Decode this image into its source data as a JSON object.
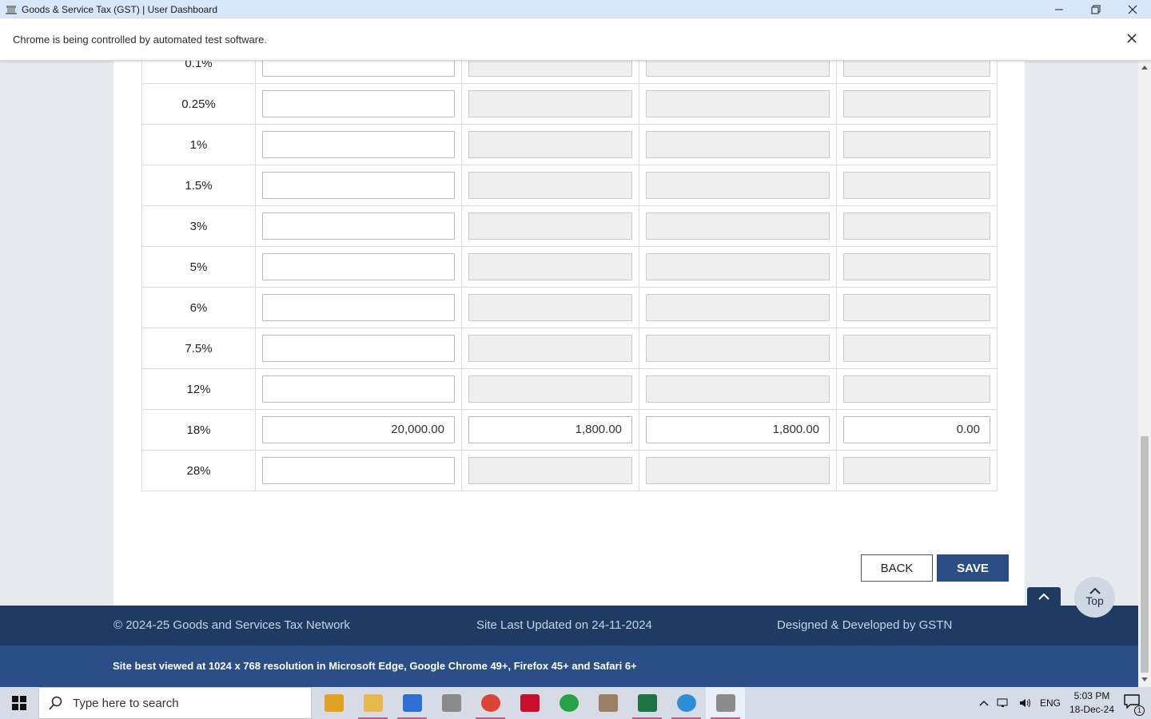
{
  "window": {
    "title": "Goods & Service Tax (GST) | User Dashboard",
    "controls": [
      "minimize-icon",
      "restore-icon",
      "close-icon"
    ]
  },
  "infobar": {
    "message": "Chrome is being controlled by automated test software."
  },
  "table": {
    "rows": [
      {
        "rate": "0.1%",
        "taxable_value": "",
        "integrated_tax": "",
        "central_tax": "",
        "state_tax": ""
      },
      {
        "rate": "0.25%",
        "taxable_value": "",
        "integrated_tax": "",
        "central_tax": "",
        "state_tax": ""
      },
      {
        "rate": "1%",
        "taxable_value": "",
        "integrated_tax": "",
        "central_tax": "",
        "state_tax": ""
      },
      {
        "rate": "1.5%",
        "taxable_value": "",
        "integrated_tax": "",
        "central_tax": "",
        "state_tax": ""
      },
      {
        "rate": "3%",
        "taxable_value": "",
        "integrated_tax": "",
        "central_tax": "",
        "state_tax": ""
      },
      {
        "rate": "5%",
        "taxable_value": "",
        "integrated_tax": "",
        "central_tax": "",
        "state_tax": ""
      },
      {
        "rate": "6%",
        "taxable_value": "",
        "integrated_tax": "",
        "central_tax": "",
        "state_tax": ""
      },
      {
        "rate": "7.5%",
        "taxable_value": "",
        "integrated_tax": "",
        "central_tax": "",
        "state_tax": ""
      },
      {
        "rate": "12%",
        "taxable_value": "",
        "integrated_tax": "",
        "central_tax": "",
        "state_tax": ""
      },
      {
        "rate": "18%",
        "taxable_value": "20,000.00",
        "integrated_tax": "1,800.00",
        "central_tax": "1,800.00",
        "state_tax": "0.00"
      },
      {
        "rate": "28%",
        "taxable_value": "",
        "integrated_tax": "",
        "central_tax": "",
        "state_tax": ""
      }
    ]
  },
  "actions": {
    "back_label": "BACK",
    "save_label": "SAVE"
  },
  "footer": {
    "copyright": "© 2024-25 Goods and Services Tax Network",
    "last_updated": "Site Last Updated on 24-11-2024",
    "developer": "Designed & Developed by GSTN",
    "browser_note": "Site best viewed at 1024 x 768 resolution in Microsoft Edge, Google Chrome 49+, Firefox 45+ and Safari 6+",
    "top_label": "Top"
  },
  "taskbar": {
    "search_placeholder": "Type here to search",
    "apps": [
      "lightning-app-icon",
      "file-explorer-icon",
      "blue-app-icon",
      "network-app-icon",
      "chrome-icon",
      "acrobat-icon",
      "whatsapp-icon",
      "pdf-app-icon",
      "excel-icon",
      "internet-explorer-icon",
      "gst-app-icon"
    ],
    "language": "ENG",
    "time": "5:03 PM",
    "date": "18-Dec-24",
    "notification_count": "1"
  },
  "colors": {
    "footer_dark": "#1f3b64",
    "footer_blue": "#2c4e86",
    "save_button": "#2c4e86"
  }
}
